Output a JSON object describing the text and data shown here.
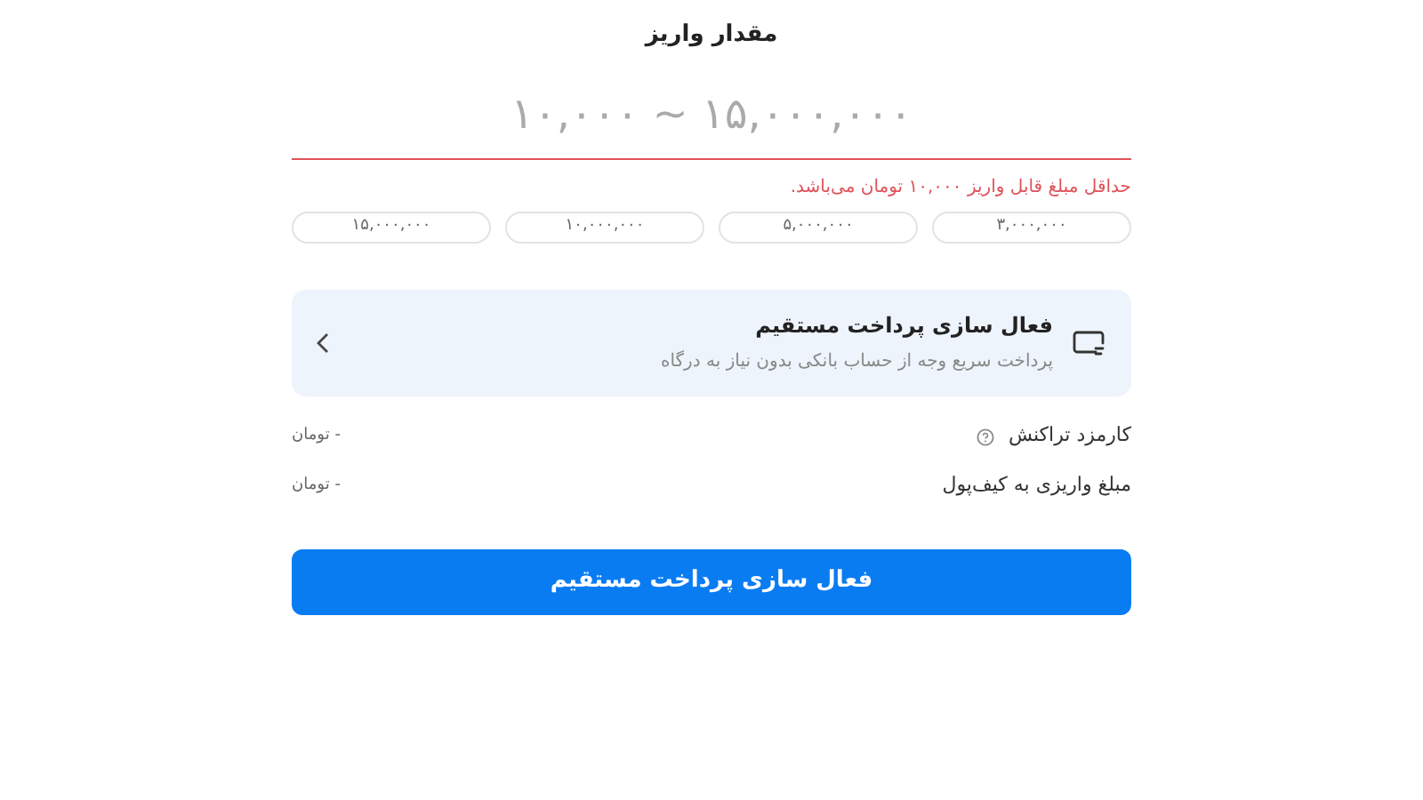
{
  "title": "مقدار واریز",
  "amount_field": {
    "placeholder": "۱۰,۰۰۰ ~ ۱۵,۰۰۰,۰۰۰",
    "invalid": true,
    "error": "حداقل مبلغ قابل واریز ۱۰,۰۰۰ تومان می‌باشد."
  },
  "presets": [
    "۳,۰۰۰,۰۰۰",
    "۵,۰۰۰,۰۰۰",
    "۱۰,۰۰۰,۰۰۰",
    "۱۵,۰۰۰,۰۰۰"
  ],
  "direct_pay_card": {
    "title": "فعال سازی پرداخت مستقیم",
    "subtitle": "پرداخت سریع وجه از حساب بانکی بدون نیاز به درگاه"
  },
  "summary": [
    {
      "label": "کارمزد تراکنش",
      "help": true,
      "value": "- تومان"
    },
    {
      "label": "مبلغ واریزی به کیف‌پول",
      "help": false,
      "value": "- تومان"
    }
  ],
  "submit_button": "فعال سازی پرداخت مستقیم"
}
